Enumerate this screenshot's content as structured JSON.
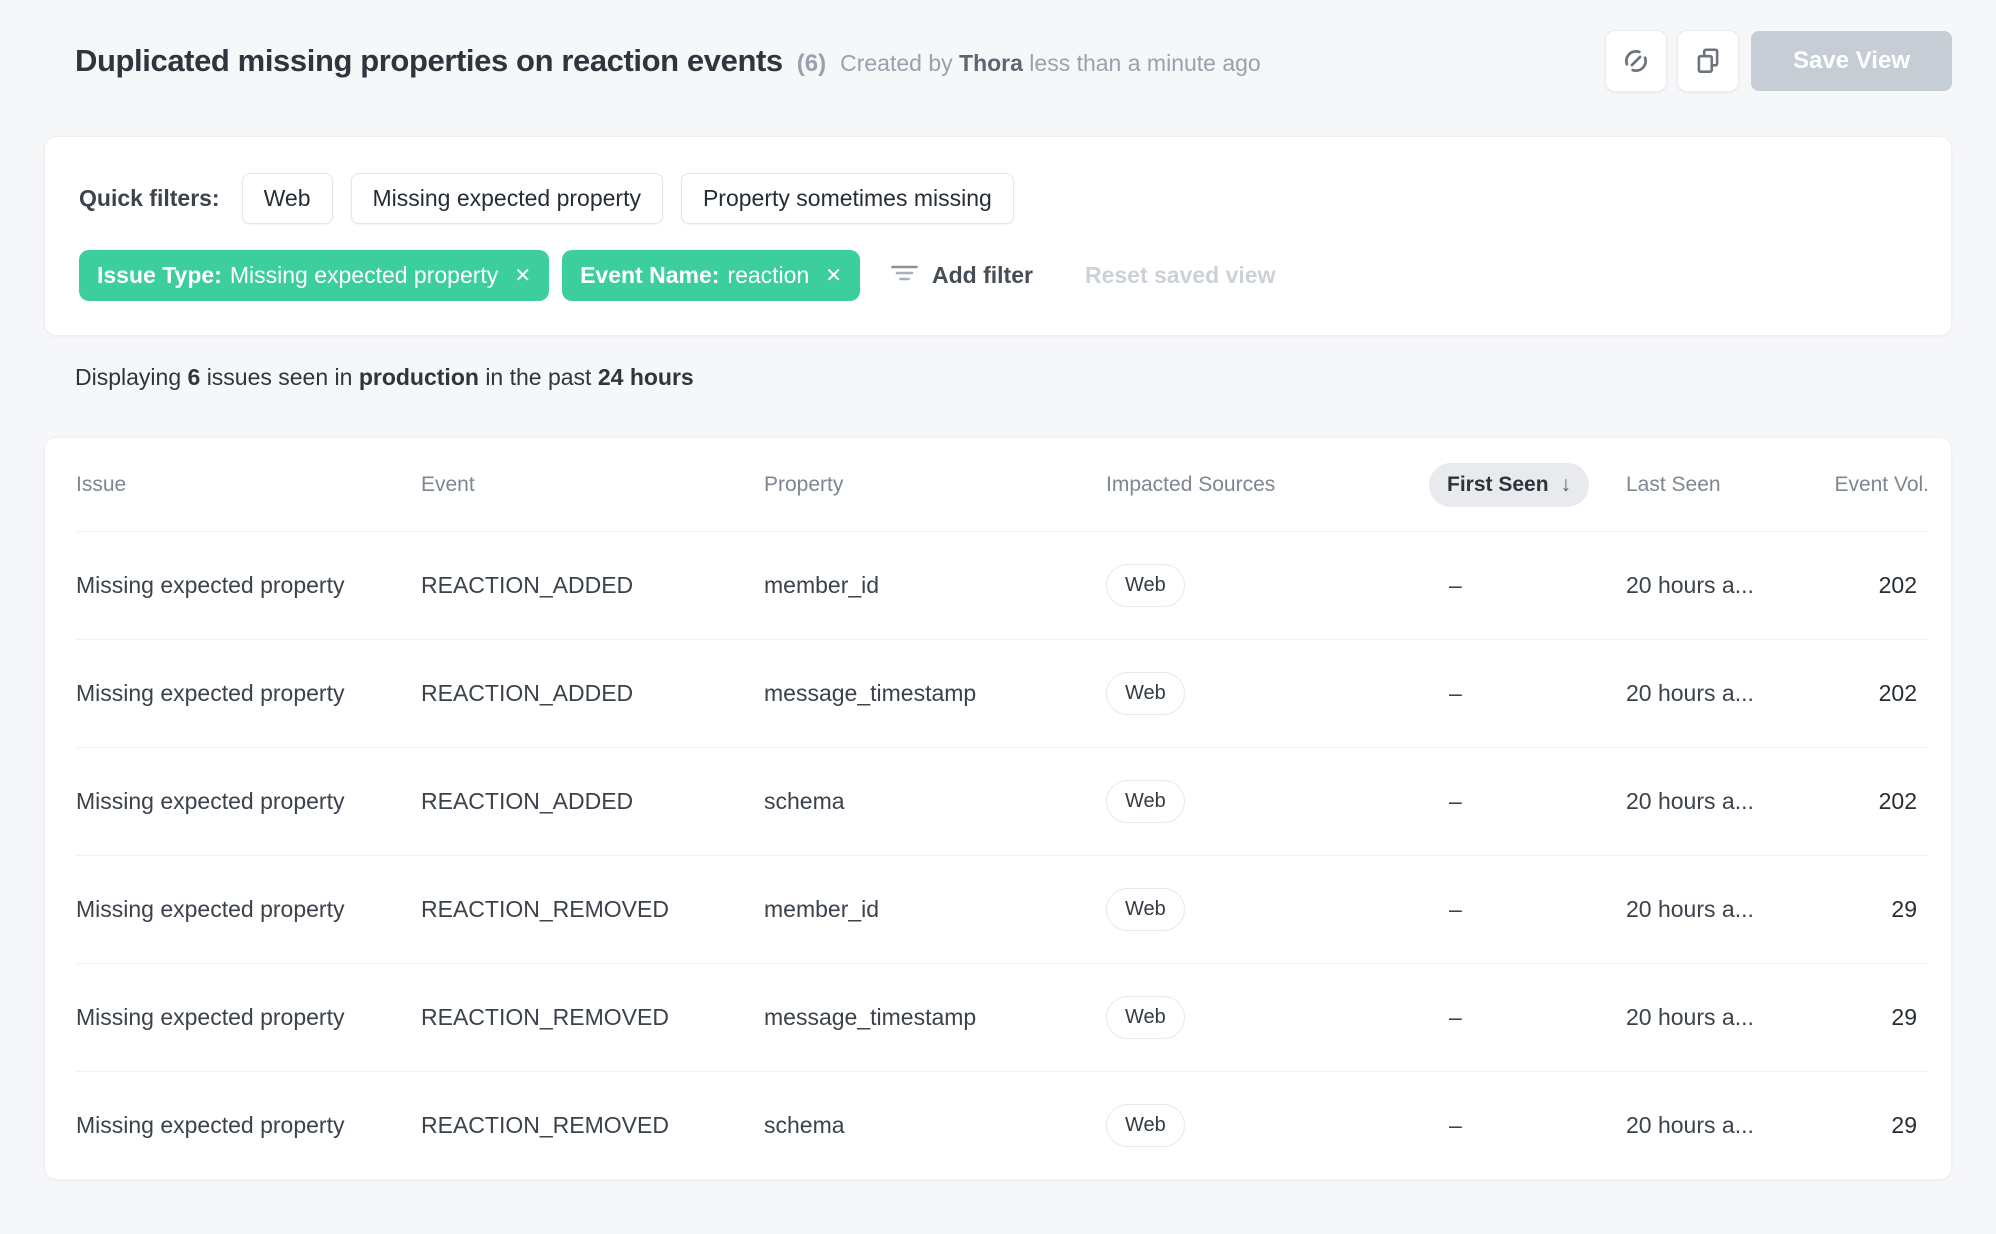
{
  "header": {
    "title": "Duplicated missing properties on reaction events",
    "count": "(6)",
    "created_by_prefix": "Created by",
    "created_by_name": "Thora",
    "created_by_suffix": "less than a minute ago",
    "save_view_label": "Save View"
  },
  "filters": {
    "quick_filters_label": "Quick filters:",
    "quick_filters": [
      "Web",
      "Missing expected property",
      "Property sometimes missing"
    ],
    "active_filters": [
      {
        "label": "Issue Type:",
        "value": "Missing expected property",
        "close_glyph": "✕"
      },
      {
        "label": "Event Name:",
        "value": "reaction",
        "close_glyph": "✕"
      }
    ],
    "add_filter_label": "Add filter",
    "reset_label": "Reset saved view"
  },
  "summary": {
    "prefix": "Displaying",
    "count": "6",
    "mid1": "issues seen in",
    "environment": "production",
    "mid2": "in the past",
    "range": "24 hours"
  },
  "table": {
    "columns": {
      "issue": "Issue",
      "event": "Event",
      "property": "Property",
      "impacted_sources": "Impacted Sources",
      "first_seen": "First Seen",
      "last_seen": "Last Seen",
      "event_vol": "Event Vol."
    },
    "sort": {
      "column": "First Seen",
      "direction_glyph": "↓"
    },
    "rows": [
      {
        "issue": "Missing expected property",
        "event": "REACTION_ADDED",
        "property": "member_id",
        "source": "Web",
        "first_seen": "–",
        "last_seen": "20 hours a...",
        "volume": "202"
      },
      {
        "issue": "Missing expected property",
        "event": "REACTION_ADDED",
        "property": "message_timestamp",
        "source": "Web",
        "first_seen": "–",
        "last_seen": "20 hours a...",
        "volume": "202"
      },
      {
        "issue": "Missing expected property",
        "event": "REACTION_ADDED",
        "property": "schema",
        "source": "Web",
        "first_seen": "–",
        "last_seen": "20 hours a...",
        "volume": "202"
      },
      {
        "issue": "Missing expected property",
        "event": "REACTION_REMOVED",
        "property": "member_id",
        "source": "Web",
        "first_seen": "–",
        "last_seen": "20 hours a...",
        "volume": "29"
      },
      {
        "issue": "Missing expected property",
        "event": "REACTION_REMOVED",
        "property": "message_timestamp",
        "source": "Web",
        "first_seen": "–",
        "last_seen": "20 hours a...",
        "volume": "29"
      },
      {
        "issue": "Missing expected property",
        "event": "REACTION_REMOVED",
        "property": "schema",
        "source": "Web",
        "first_seen": "–",
        "last_seen": "20 hours a...",
        "volume": "29"
      }
    ]
  },
  "colors": {
    "accent_green": "#3cce9d",
    "page_background": "#f6f7f9",
    "card_background": "#ffffff",
    "title_text": "#2f353d",
    "muted_text": "#9aa1ac",
    "disabled_button": "#c7cdd5",
    "sort_pill_background": "#e8eaee",
    "row_divider": "#f0f2f5"
  }
}
